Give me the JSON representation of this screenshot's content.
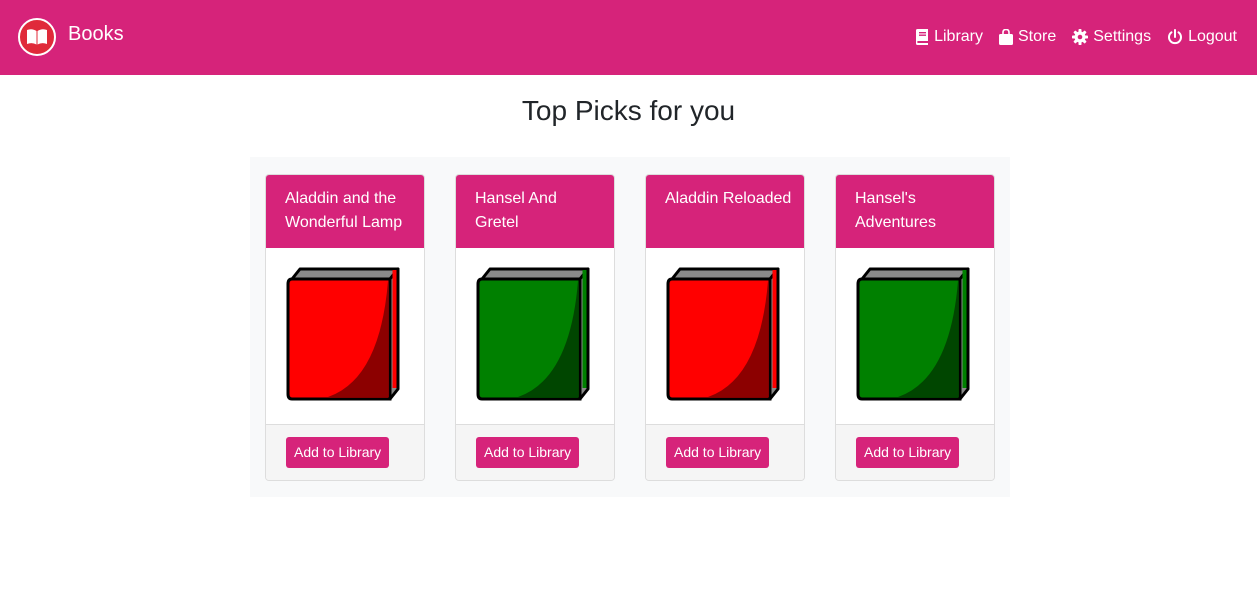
{
  "header": {
    "brand": "Books",
    "nav": [
      {
        "label": "Library",
        "icon": "book-icon"
      },
      {
        "label": "Store",
        "icon": "shopping-bag-icon"
      },
      {
        "label": "Settings",
        "icon": "gear-icon"
      },
      {
        "label": "Logout",
        "icon": "power-icon"
      }
    ]
  },
  "main": {
    "title": "Top Picks for you",
    "books": [
      {
        "title": "Aladdin and the Wonderful Lamp",
        "cover_color": "#ff0000",
        "button": "Add to Library"
      },
      {
        "title": "Hansel And Gretel",
        "cover_color": "#008000",
        "button": "Add to Library"
      },
      {
        "title": "Aladdin Reloaded",
        "cover_color": "#ff0000",
        "button": "Add to Library"
      },
      {
        "title": "Hansel's Adventures",
        "cover_color": "#008000",
        "button": "Add to Library"
      }
    ]
  },
  "colors": {
    "brand": "#d6237a",
    "shelf_bg": "#f8f9fa",
    "card_footer_bg": "#f5f5f5"
  }
}
